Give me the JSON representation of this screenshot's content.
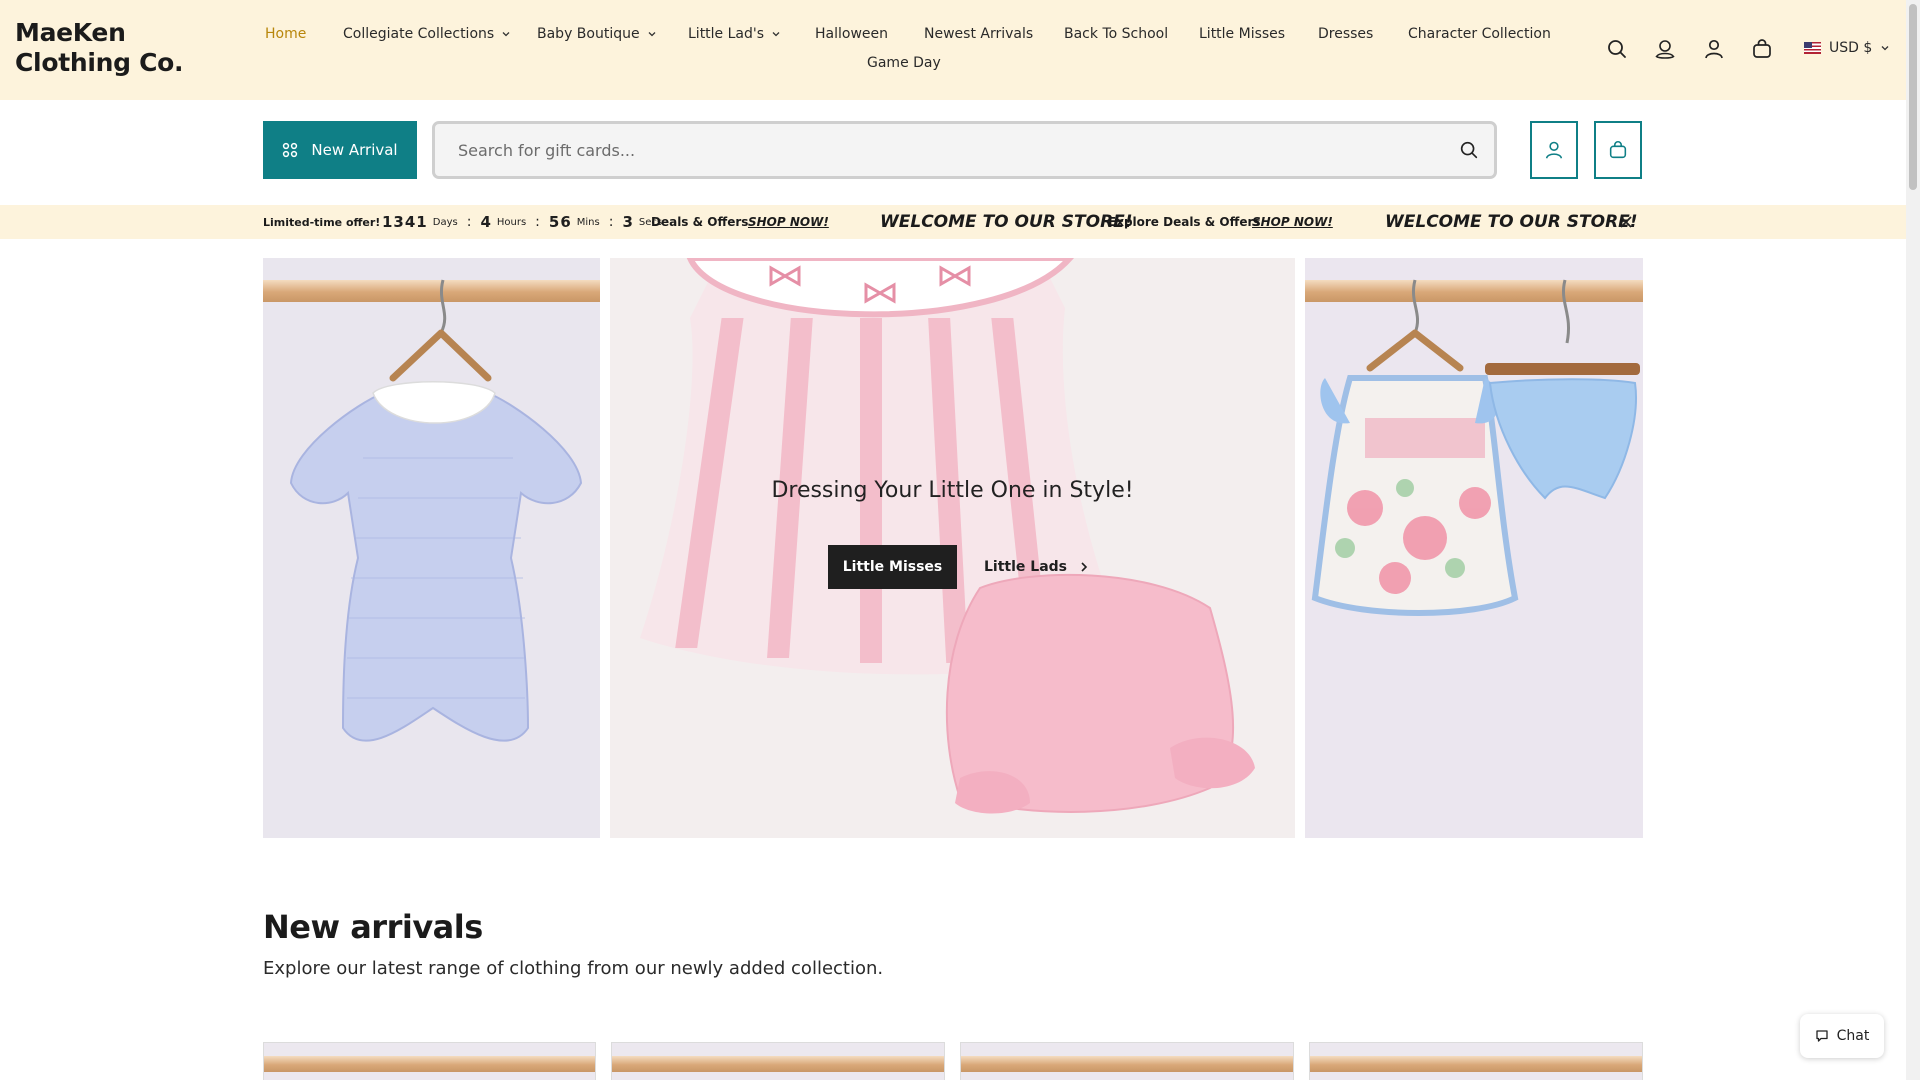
{
  "brand": {
    "line1": "MaeKen",
    "line2": "Clothing Co."
  },
  "nav": {
    "items": [
      {
        "label": "Home",
        "has_dropdown": false,
        "active": true
      },
      {
        "label": "Collegiate Collections",
        "has_dropdown": true
      },
      {
        "label": "Baby Boutique",
        "has_dropdown": true
      },
      {
        "label": "Little Lad's",
        "has_dropdown": true
      },
      {
        "label": "Halloween",
        "has_dropdown": false
      },
      {
        "label": "Newest Arrivals",
        "has_dropdown": false
      },
      {
        "label": "Back To School",
        "has_dropdown": false
      },
      {
        "label": "Little Misses",
        "has_dropdown": false
      },
      {
        "label": "Dresses",
        "has_dropdown": false
      },
      {
        "label": "Character Collection",
        "has_dropdown": false
      },
      {
        "label": "Game Day",
        "has_dropdown": false
      }
    ],
    "currency": "USD $",
    "icons": [
      "search-icon",
      "account-circle-icon",
      "user-icon",
      "bag-icon"
    ]
  },
  "search_row": {
    "new_arrival_label": "New Arrival",
    "search_placeholder": "Search for gift cards...",
    "accent_color": "#0f7f86"
  },
  "announcement": {
    "offer_label": "Limited-time offer!",
    "countdown": [
      {
        "value": "1341",
        "unit": "Days"
      },
      {
        "value": "4",
        "unit": "Hours"
      },
      {
        "value": "56",
        "unit": "Mins"
      },
      {
        "value": "3",
        "unit": "Secs"
      }
    ],
    "deals_partial": "Deals & Offers",
    "deals_label": "Explore Deals & Offers",
    "shop_now": "SHOP NOW!",
    "welcome": "WELCOME TO OUR STORE!",
    "background": "#fdf3dc"
  },
  "hero": {
    "title": "Dressing Your Little One in Style!",
    "primary_button": "Little Misses",
    "secondary_button": "Little Lads"
  },
  "new_arrivals": {
    "title": "New arrivals",
    "subtitle": "Explore our latest range of clothing from our newly added collection."
  },
  "chat": {
    "label": "Chat"
  }
}
